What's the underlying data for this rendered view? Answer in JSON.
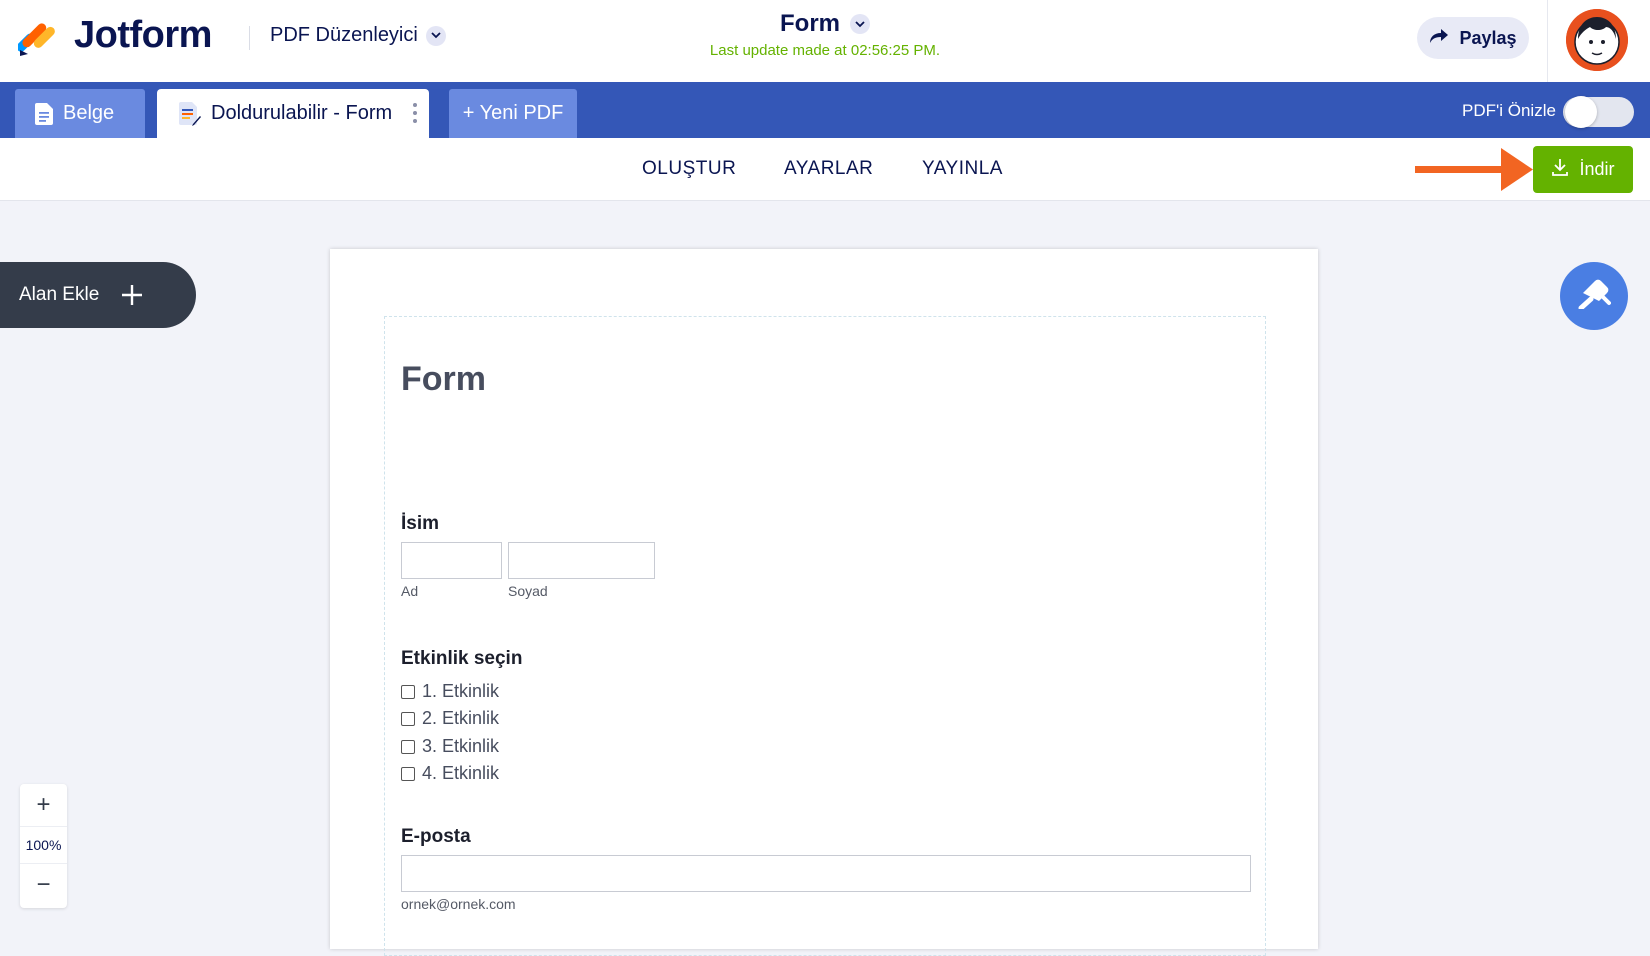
{
  "header": {
    "brand": "Jotform",
    "product": "PDF Düzenleyici",
    "title": "Form",
    "last_update": "Last update made at 02:56:25 PM.",
    "share_label": "Paylaş"
  },
  "tabs": {
    "belge": "Belge",
    "form": "Doldurulabilir - Form",
    "new": "+ Yeni PDF",
    "preview_label": "PDF'i Önizle",
    "preview_on": false
  },
  "nav": {
    "items": [
      "OLUŞTUR",
      "AYARLAR",
      "YAYINLA"
    ],
    "download_label": "İndir"
  },
  "sidebar": {
    "add_field": "Alan Ekle"
  },
  "zoom": {
    "plus": "+",
    "value": "100%",
    "minus": "−"
  },
  "form": {
    "title": "Form",
    "name_label": "İsim",
    "first_name_sub": "Ad",
    "last_name_sub": "Soyad",
    "events_label": "Etkinlik seçin",
    "events": [
      "1. Etkinlik",
      "2. Etkinlik",
      "3. Etkinlik",
      "4. Etkinlik"
    ],
    "email_label": "E-posta",
    "email_sub": "ornek@ornek.com"
  },
  "colors": {
    "brand_blue": "#3457b7",
    "download_green": "#64b200",
    "arrow_orange": "#f26522",
    "navy": "#0a1551"
  }
}
